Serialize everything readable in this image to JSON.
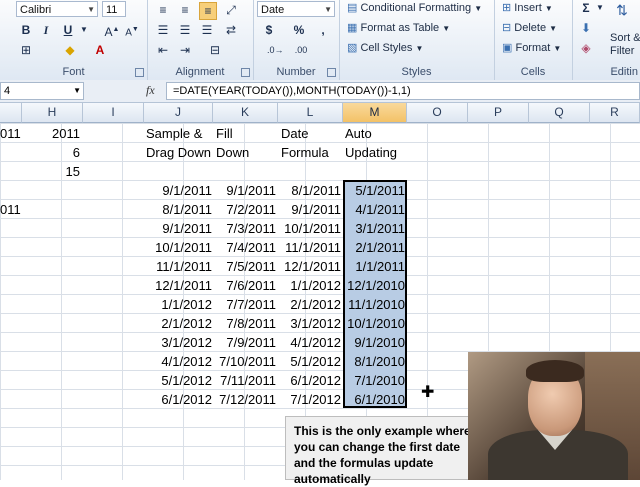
{
  "ribbon": {
    "font": {
      "name": "Calibri",
      "size": "11",
      "group_label": "Font"
    },
    "alignment": {
      "group_label": "Alignment"
    },
    "number": {
      "format": "Date",
      "currency_symbol": "$",
      "percent_symbol": "%",
      "comma_symbol": ",",
      "group_label": "Number"
    },
    "styles": {
      "conditional_formatting": "Conditional Formatting",
      "format_as_table": "Format as Table",
      "cell_styles": "Cell Styles",
      "group_label": "Styles"
    },
    "cells": {
      "insert": "Insert",
      "delete": "Delete",
      "format": "Format",
      "group_label": "Cells"
    },
    "editing": {
      "sort_filter_line1": "Sort &",
      "sort_filter_line2": "Filter",
      "group_label": "Editin"
    }
  },
  "formula_bar": {
    "name_box": "4",
    "fx": "fx",
    "formula": "=DATE(YEAR(TODAY()),MONTH(TODAY())-1,1)"
  },
  "columns": [
    "H",
    "I",
    "J",
    "K",
    "L",
    "M",
    "O",
    "P",
    "Q",
    "R"
  ],
  "selected_column": "M",
  "cells": {
    "g_row1": "011",
    "g_row5": "011",
    "h_row1": "2011",
    "h_row2": "6",
    "h_row3": "15",
    "j_header1": "Sample &",
    "j_header2": "Drag Down",
    "k_header1": "Fill",
    "k_header2": "Down",
    "l_header1": "Date",
    "l_header2": "Formula",
    "m_header1": "Auto",
    "m_header2": "Updating"
  },
  "table_rows": [
    {
      "j": "9/1/2011",
      "k": "9/1/2011",
      "l": "8/1/2011",
      "m": "5/1/2011"
    },
    {
      "j": "8/1/2011",
      "k": "7/2/2011",
      "l": "9/1/2011",
      "m": "4/1/2011"
    },
    {
      "j": "9/1/2011",
      "k": "7/3/2011",
      "l": "10/1/2011",
      "m": "3/1/2011"
    },
    {
      "j": "10/1/2011",
      "k": "7/4/2011",
      "l": "11/1/2011",
      "m": "2/1/2011"
    },
    {
      "j": "11/1/2011",
      "k": "7/5/2011",
      "l": "12/1/2011",
      "m": "1/1/2011"
    },
    {
      "j": "12/1/2011",
      "k": "7/6/2011",
      "l": "1/1/2012",
      "m": "12/1/2010"
    },
    {
      "j": "1/1/2012",
      "k": "7/7/2011",
      "l": "2/1/2012",
      "m": "11/1/2010"
    },
    {
      "j": "2/1/2012",
      "k": "7/8/2011",
      "l": "3/1/2012",
      "m": "10/1/2010"
    },
    {
      "j": "3/1/2012",
      "k": "7/9/2011",
      "l": "4/1/2012",
      "m": "9/1/2010"
    },
    {
      "j": "4/1/2012",
      "k": "7/10/2011",
      "l": "5/1/2012",
      "m": "8/1/2010"
    },
    {
      "j": "5/1/2012",
      "k": "7/11/2011",
      "l": "6/1/2012",
      "m": "7/1/2010"
    },
    {
      "j": "6/1/2012",
      "k": "7/12/2011",
      "l": "7/1/2012",
      "m": "6/1/2010"
    }
  ],
  "note": {
    "line1": "This is the only example where",
    "line2": "you can change the first date",
    "line3": "and the formulas update",
    "line4": "automatically"
  }
}
